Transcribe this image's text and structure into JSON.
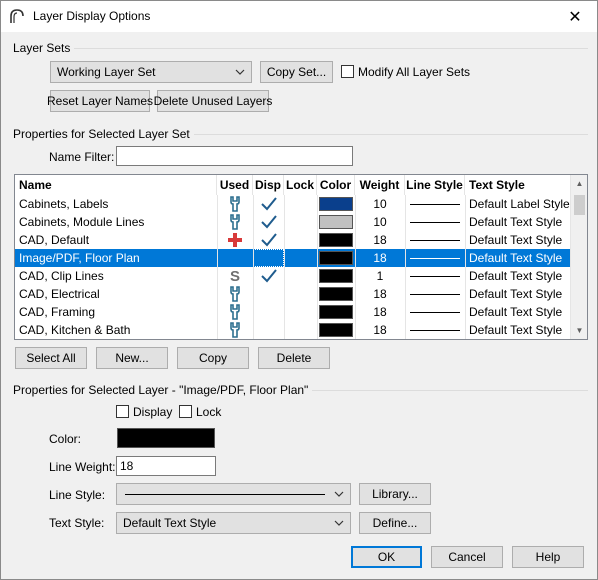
{
  "window": {
    "title": "Layer Display Options",
    "close_glyph": "✕"
  },
  "layer_sets": {
    "group_label": "Layer Sets",
    "selected_set": "Working Layer Set",
    "copy_set_label": "Copy Set...",
    "modify_all_label": "Modify All Layer Sets",
    "modify_all_checked": false,
    "reset_names_label": "Reset Layer Names",
    "delete_unused_label": "Delete Unused Layers"
  },
  "props_set": {
    "group_label": "Properties for Selected Layer Set",
    "name_filter_label": "Name Filter:",
    "name_filter_value": ""
  },
  "table": {
    "columns": [
      "Name",
      "Used",
      "Disp",
      "Lock",
      "Color",
      "Weight",
      "Line Style",
      "Text Style"
    ],
    "sort_indicator": "^",
    "rows": [
      {
        "name": "Cabinets, Labels",
        "used": "used-icon",
        "disp": true,
        "lock": false,
        "color": "#0a3f8c",
        "weight": "10",
        "text_style": "Default Label Style",
        "selected": false
      },
      {
        "name": "Cabinets, Module Lines",
        "used": "used-icon",
        "disp": true,
        "lock": false,
        "color": "#c0c0c0",
        "weight": "10",
        "text_style": "Default Text Style",
        "selected": false
      },
      {
        "name": "CAD,  Default",
        "used": "default-icon",
        "disp": true,
        "lock": false,
        "color": "#000000",
        "weight": "18",
        "text_style": "Default Text Style",
        "selected": false
      },
      {
        "name": "Image/PDF, Floor Plan",
        "used": "none",
        "disp": false,
        "lock": false,
        "color": "#000000",
        "weight": "18",
        "text_style": "Default Text Style",
        "selected": true
      },
      {
        "name": "CAD, Clip Lines",
        "used": "s-icon",
        "disp": true,
        "lock": false,
        "color": "#000000",
        "weight": "1",
        "text_style": "Default Text Style",
        "selected": false
      },
      {
        "name": "CAD, Electrical",
        "used": "used-icon",
        "disp": false,
        "lock": false,
        "color": "#000000",
        "weight": "18",
        "text_style": "Default Text Style",
        "selected": false
      },
      {
        "name": "CAD, Framing",
        "used": "used-icon",
        "disp": false,
        "lock": false,
        "color": "#000000",
        "weight": "18",
        "text_style": "Default Text Style",
        "selected": false
      },
      {
        "name": "CAD, Kitchen & Bath",
        "used": "used-icon",
        "disp": false,
        "lock": false,
        "color": "#000000",
        "weight": "18",
        "text_style": "Default Text Style",
        "selected": false
      }
    ]
  },
  "table_buttons": {
    "select_all": "Select All",
    "new": "New...",
    "copy": "Copy",
    "delete": "Delete"
  },
  "props_layer": {
    "group_label": "Properties for Selected Layer - \"Image/PDF, Floor Plan\"",
    "display_label": "Display",
    "display_checked": false,
    "lock_label": "Lock",
    "lock_checked": false,
    "color_label": "Color:",
    "color_value": "#000000",
    "line_weight_label": "Line Weight:",
    "line_weight_value": "18",
    "line_style_label": "Line Style:",
    "library_label": "Library...",
    "text_style_label": "Text Style:",
    "text_style_value": "Default Text Style",
    "define_label": "Define..."
  },
  "footer": {
    "ok": "OK",
    "cancel": "Cancel",
    "help": "Help"
  },
  "colors": {
    "accent": "#0078d7",
    "checkmark": "#1f5c8e",
    "used_icon": "#2d6f8f",
    "default_icon": "#d83a3a",
    "s_icon": "#707070"
  }
}
